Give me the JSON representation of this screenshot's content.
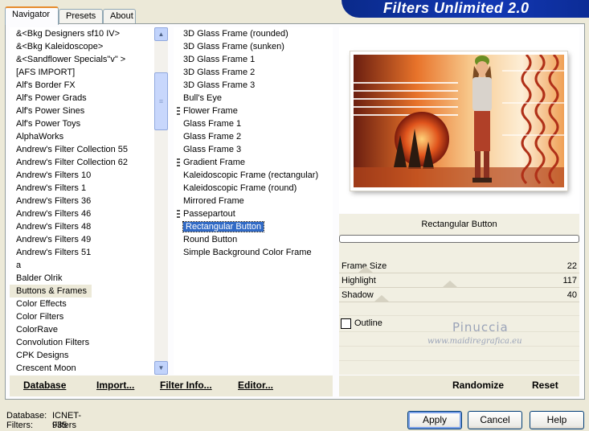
{
  "banner": {
    "title": "Filters Unlimited 2.0"
  },
  "tabs": [
    {
      "label": "Navigator",
      "active": true
    },
    {
      "label": "Presets",
      "active": false
    },
    {
      "label": "About",
      "active": false
    }
  ],
  "categories": [
    "&<Bkg Designers sf10 IV>",
    "&<Bkg Kaleidoscope>",
    "&<Sandflower Specials\"v\" >",
    "[AFS IMPORT]",
    "Alf's Border FX",
    "Alf's Power Grads",
    "Alf's Power Sines",
    "Alf's Power Toys",
    "AlphaWorks",
    "Andrew's Filter Collection 55",
    "Andrew's Filter Collection 62",
    "Andrew's Filters 10",
    "Andrew's Filters 1",
    "Andrew's Filters 36",
    "Andrew's Filters 46",
    "Andrew's Filters 48",
    "Andrew's Filters 49",
    "Andrew's Filters 51",
    "a",
    "Balder Olrik",
    "Buttons & Frames",
    "Color Effects",
    "Color Filters",
    "ColorRave",
    "Convolution Filters",
    "CPK Designs",
    "Crescent Moon"
  ],
  "selected_category": "Buttons & Frames",
  "filters": [
    {
      "label": "3D Glass Frame (rounded)",
      "marked": false
    },
    {
      "label": "3D Glass Frame (sunken)",
      "marked": false
    },
    {
      "label": "3D Glass Frame 1",
      "marked": false
    },
    {
      "label": "3D Glass Frame 2",
      "marked": false
    },
    {
      "label": "3D Glass Frame 3",
      "marked": false
    },
    {
      "label": "Bull's Eye",
      "marked": false
    },
    {
      "label": "Flower Frame",
      "marked": true
    },
    {
      "label": "Glass Frame 1",
      "marked": false
    },
    {
      "label": "Glass Frame 2",
      "marked": false
    },
    {
      "label": "Glass Frame 3",
      "marked": false
    },
    {
      "label": "Gradient Frame",
      "marked": true
    },
    {
      "label": "Kaleidoscopic Frame (rectangular)",
      "marked": false
    },
    {
      "label": "Kaleidoscopic Frame (round)",
      "marked": false
    },
    {
      "label": "Mirrored Frame",
      "marked": false
    },
    {
      "label": "Passepartout",
      "marked": true
    },
    {
      "label": "Rectangular Button",
      "marked": false
    },
    {
      "label": "Round Button",
      "marked": false
    },
    {
      "label": "Simple Background Color Frame",
      "marked": false
    }
  ],
  "selected_filter": "Rectangular Button",
  "params": {
    "filter_name": "Rectangular Button",
    "progress": 0,
    "sliders": [
      {
        "label": "Frame Size",
        "value": "22",
        "max": 255
      },
      {
        "label": "Highlight",
        "value": "117",
        "max": 255
      },
      {
        "label": "Shadow",
        "value": "40",
        "max": 255
      }
    ],
    "outline": {
      "label": "Outline",
      "checked": false
    },
    "watermark": {
      "name": "Pinuccia",
      "url": "www.maidiregrafica.eu"
    }
  },
  "toolbar": {
    "database": "Database",
    "import": "Import...",
    "filter_info": "Filter Info...",
    "editor": "Editor...",
    "randomize": "Randomize",
    "reset": "Reset"
  },
  "status": {
    "database_label": "Database:",
    "database_value": "ICNET-Filters",
    "filters_label": "Filters:",
    "filters_value": "935"
  },
  "buttons": {
    "apply": "Apply",
    "cancel": "Cancel",
    "help": "Help"
  },
  "colors": {
    "banner": "#1238b4",
    "selection": "#316ac5",
    "accent": "#e68b2c"
  }
}
